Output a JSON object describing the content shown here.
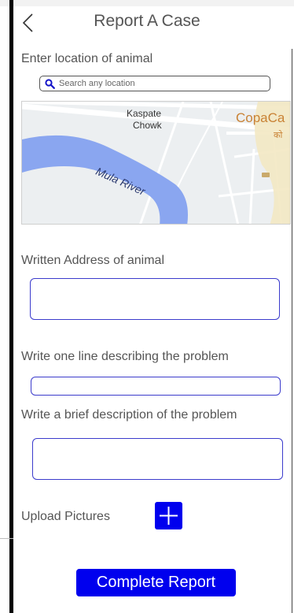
{
  "header": {
    "title": "Report A Case"
  },
  "location": {
    "label": "Enter location of animal",
    "search_placeholder": "Search any location",
    "map": {
      "place_line1": "Kaspate",
      "place_line2": "Chowk",
      "business_name": "CopaCa",
      "business_sub": "को",
      "river_name": "Mula River"
    }
  },
  "address": {
    "label": "Written Address of animal",
    "value": ""
  },
  "summary": {
    "label": "Write one line describing the problem",
    "value": ""
  },
  "description": {
    "label": "Write a brief description of the problem",
    "value": ""
  },
  "upload": {
    "label": "Upload Pictures"
  },
  "submit": {
    "label": "Complete Report"
  },
  "colors": {
    "accent": "#0000ee",
    "field_border": "#3b3bcc",
    "text": "#555555"
  }
}
